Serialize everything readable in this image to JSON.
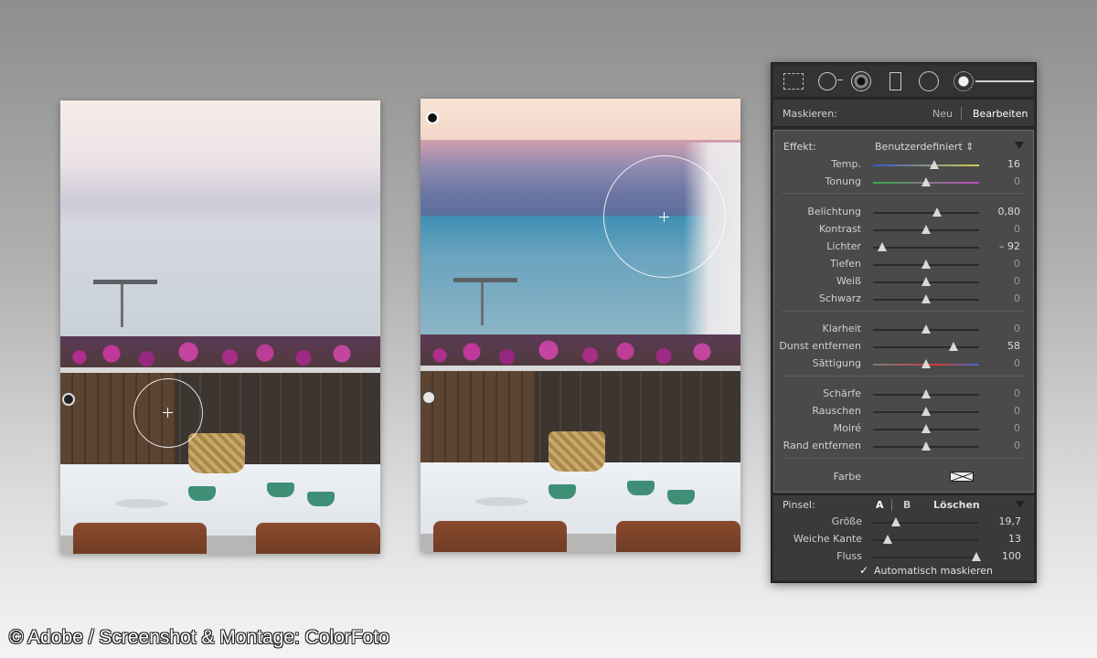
{
  "toolbar": {
    "tools": [
      "crop-overlay-icon",
      "spot-removal-icon",
      "red-eye-icon",
      "graduated-filter-icon",
      "radial-filter-icon",
      "adjustment-brush-icon"
    ]
  },
  "mask": {
    "label": "Maskieren:",
    "new_label": "Neu",
    "edit_label": "Bearbeiten"
  },
  "effect": {
    "label": "Effekt:",
    "preset": "Benutzerdefiniert ⇕"
  },
  "sliders": [
    {
      "name": "Temp.",
      "value": "16",
      "pos": 0.58,
      "track": "temp"
    },
    {
      "name": "Tonung",
      "value": "0",
      "pos": 0.5,
      "track": "tint"
    },
    {
      "name": "Belichtung",
      "value": "0,80",
      "pos": 0.6,
      "track": "plain"
    },
    {
      "name": "Kontrast",
      "value": "0",
      "pos": 0.5,
      "track": "plain"
    },
    {
      "name": "Lichter",
      "value": "– 92",
      "pos": 0.09,
      "track": "plain"
    },
    {
      "name": "Tiefen",
      "value": "0",
      "pos": 0.5,
      "track": "plain"
    },
    {
      "name": "Weiß",
      "value": "0",
      "pos": 0.5,
      "track": "plain"
    },
    {
      "name": "Schwarz",
      "value": "0",
      "pos": 0.5,
      "track": "plain"
    },
    {
      "name": "Klarheit",
      "value": "0",
      "pos": 0.5,
      "track": "plain"
    },
    {
      "name": "Dunst entfernen",
      "value": "58",
      "pos": 0.76,
      "track": "plain"
    },
    {
      "name": "Sättigung",
      "value": "0",
      "pos": 0.5,
      "track": "sat"
    },
    {
      "name": "Schärfe",
      "value": "0",
      "pos": 0.5,
      "track": "plain"
    },
    {
      "name": "Rauschen",
      "value": "0",
      "pos": 0.5,
      "track": "plain"
    },
    {
      "name": "Moiré",
      "value": "0",
      "pos": 0.5,
      "track": "plain"
    },
    {
      "name": "Rand entfernen",
      "value": "0",
      "pos": 0.5,
      "track": "plain"
    }
  ],
  "color_label": "Farbe",
  "brush": {
    "label": "Pinsel:",
    "a": "A",
    "b": "B",
    "clear": "Löschen",
    "sliders": [
      {
        "name": "Größe",
        "value": "19,7",
        "pos": 0.22
      },
      {
        "name": "Weiche Kante",
        "value": "13",
        "pos": 0.15
      },
      {
        "name": "Fluss",
        "value": "100",
        "pos": 0.98
      }
    ],
    "automask": "Automatisch maskieren"
  },
  "credit": "© Adobe / Screenshot & Montage: ColorFoto"
}
